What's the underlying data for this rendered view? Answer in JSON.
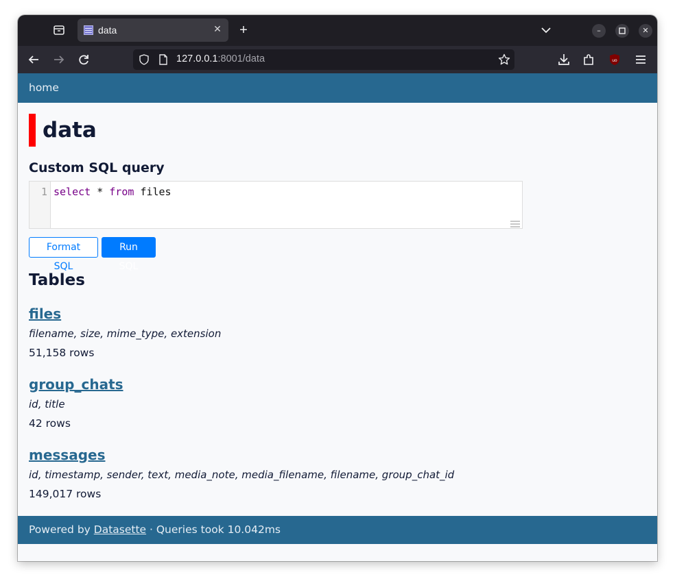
{
  "browser": {
    "tab_title": "data",
    "url_host": "127.0.0.1",
    "url_rest": ":8001/data"
  },
  "site": {
    "home_link": "home"
  },
  "database": {
    "title": "data",
    "title_accent_color": "#ff0000"
  },
  "sql": {
    "heading": "Custom SQL query",
    "line_number": "1",
    "query_parts": [
      "select",
      " * ",
      "from",
      " files"
    ],
    "format_button": "Format SQL",
    "run_button": "Run SQL"
  },
  "tables": {
    "heading": "Tables",
    "items": [
      {
        "name": "files",
        "columns": "filename, size, mime_type, extension",
        "rows": "51,158 rows"
      },
      {
        "name": "group_chats",
        "columns": "id, title",
        "rows": "42 rows"
      },
      {
        "name": "messages",
        "columns": "id, timestamp, sender, text, media_note, media_filename, filename, group_chat_id",
        "rows": "149,017 rows"
      }
    ]
  },
  "footer": {
    "prefix": "Powered by ",
    "link": "Datasette",
    "suffix": " · Queries took 10.042ms"
  },
  "colors": {
    "header_bg": "#276890",
    "link": "#276890",
    "primary_button": "#007bff"
  }
}
